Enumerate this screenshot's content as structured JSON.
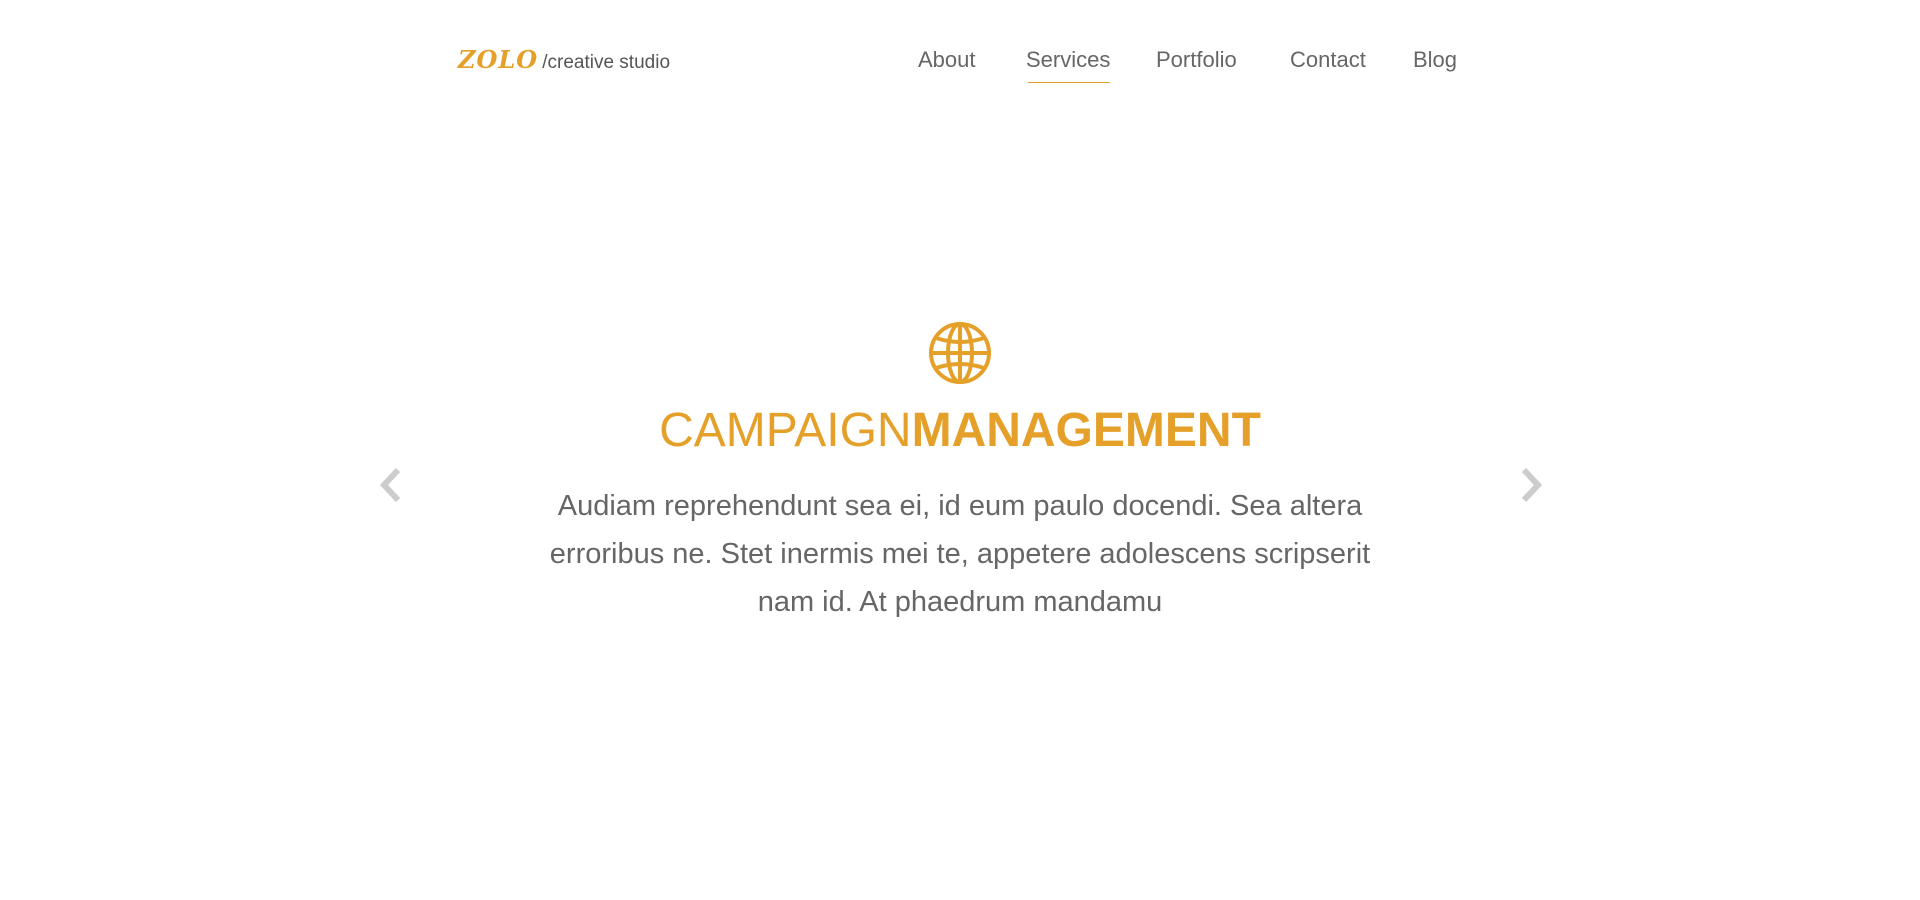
{
  "brand": {
    "logo_text": "ZOLO",
    "tagline": "/creative studio",
    "accent_color": "#e5a02a"
  },
  "nav": {
    "items": [
      {
        "label": "About",
        "active": false
      },
      {
        "label": "Services",
        "active": true
      },
      {
        "label": "Portfolio",
        "active": false
      },
      {
        "label": "Contact",
        "active": false
      },
      {
        "label": "Blog",
        "active": false
      }
    ]
  },
  "slider": {
    "prev_icon": "chevron-left-icon",
    "next_icon": "chevron-right-icon",
    "slide": {
      "icon": "globe-icon",
      "title_light": "CAMPAIGN",
      "title_bold": "MANAGEMENT",
      "body": "Audiam reprehendunt sea ei, id eum paulo docendi. Sea altera erroribus ne. Stet inermis mei te, appetere adolescens scripserit nam id. At phaedrum mandamu"
    }
  }
}
